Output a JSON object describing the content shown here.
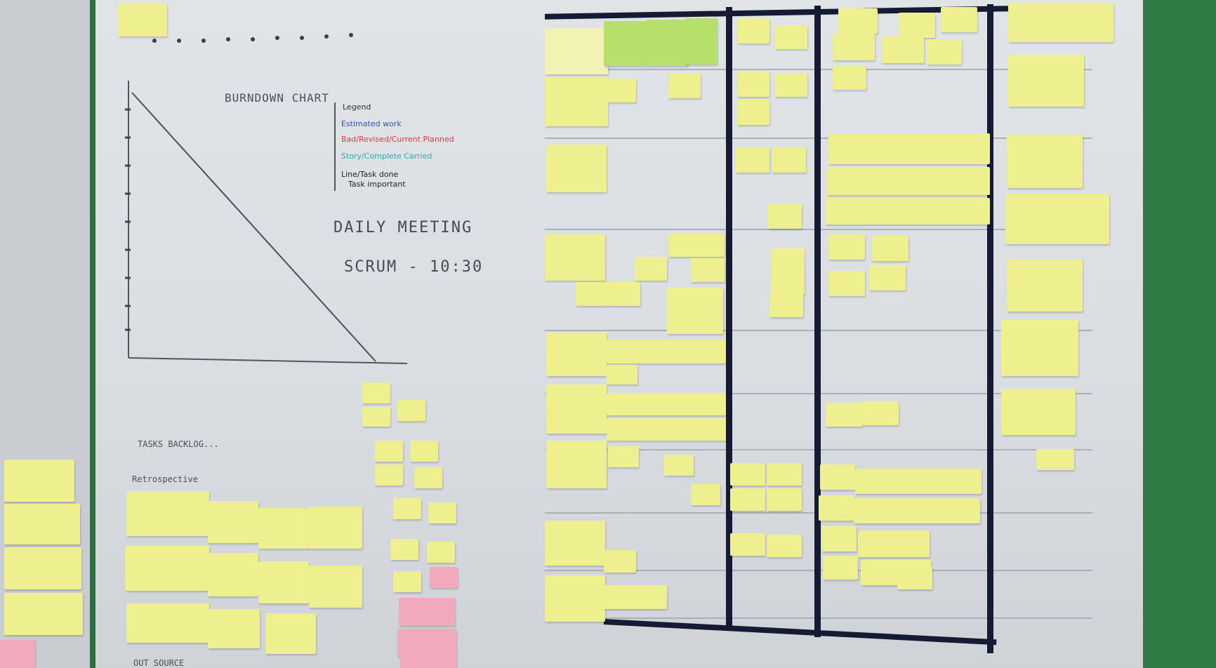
{
  "board": {
    "chart_title": "BURNDOWN CHART",
    "legend": {
      "title": "Legend",
      "items": [
        {
          "text": "Estimated work",
          "color": "#3a4fb0"
        },
        {
          "text": "Bad/Revised/Current Planned",
          "color": "#d8394f"
        },
        {
          "text": "Story/Complete Carried",
          "color": "#2aa7b5"
        },
        {
          "text": "Line/Task done",
          "color": "#222222"
        },
        {
          "text": "Task important",
          "color": "#222222"
        }
      ]
    },
    "notes": {
      "daily": "DAILY MEETING",
      "scrum": "SCRUM - 10:30"
    },
    "bottom_labels": {
      "impediments": "TASKS BACKLOG...",
      "retro": "Retrospective",
      "footer": "OUT SOURCE"
    }
  },
  "colors": {
    "sticky_yellow": "#eef08f",
    "sticky_green": "#b7e06a",
    "sticky_pink": "#f2a9bd",
    "frame_green": "#2f7a45",
    "column_divider": "#141b33"
  }
}
